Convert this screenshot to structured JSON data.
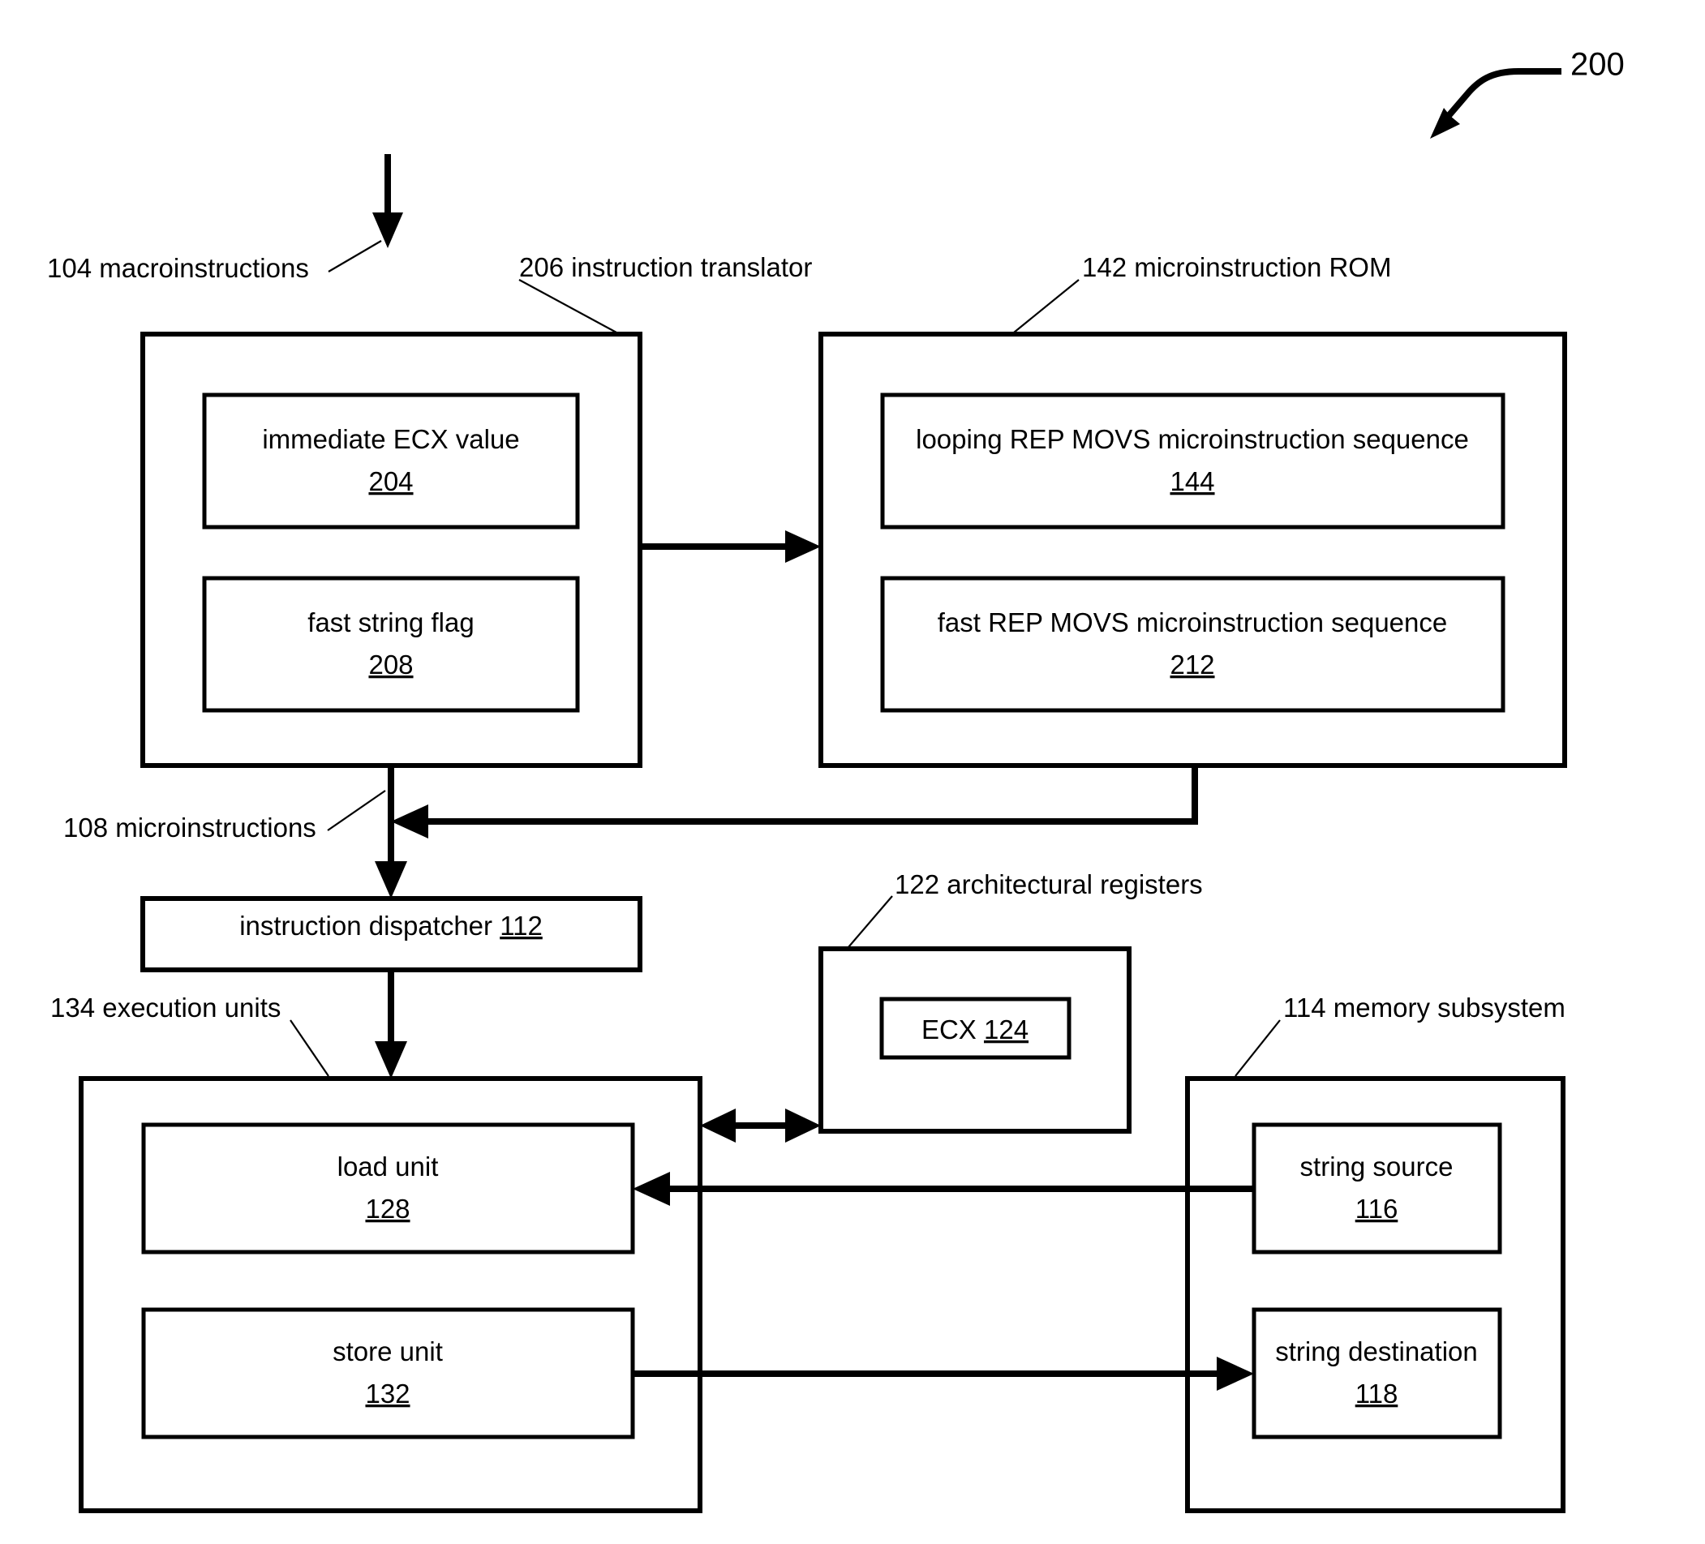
{
  "figure": {
    "number": "200",
    "callout_icon": "curved-arrow-icon"
  },
  "labels": {
    "macroinstructions": "104 macroinstructions",
    "instruction_translator": "206  instruction translator",
    "microinstruction_rom": "142  microinstruction ROM",
    "microinstructions": "108 microinstructions",
    "architectural_registers": "122 architectural registers",
    "execution_units": "134 execution units",
    "memory_subsystem": "114 memory subsystem"
  },
  "blocks": {
    "immediate_ecx_value": {
      "title": "immediate ECX value",
      "ref": "204"
    },
    "fast_string_flag": {
      "title": "fast string flag",
      "ref": "208"
    },
    "looping_rep_movs": {
      "title": "looping REP MOVS microinstruction sequence",
      "ref": "144"
    },
    "fast_rep_movs": {
      "title": "fast REP MOVS microinstruction sequence",
      "ref": "212"
    },
    "instruction_dispatcher": {
      "title": "instruction dispatcher",
      "ref": "112"
    },
    "ecx_register": {
      "title": "ECX",
      "ref": "124"
    },
    "load_unit": {
      "title": "load unit",
      "ref": "128"
    },
    "store_unit": {
      "title": "store unit",
      "ref": "132"
    },
    "string_source": {
      "title": "string source",
      "ref": "116"
    },
    "string_destination": {
      "title": "string destination",
      "ref": "118"
    }
  },
  "colors": {
    "ink": "#000000",
    "paper": "#ffffff"
  }
}
